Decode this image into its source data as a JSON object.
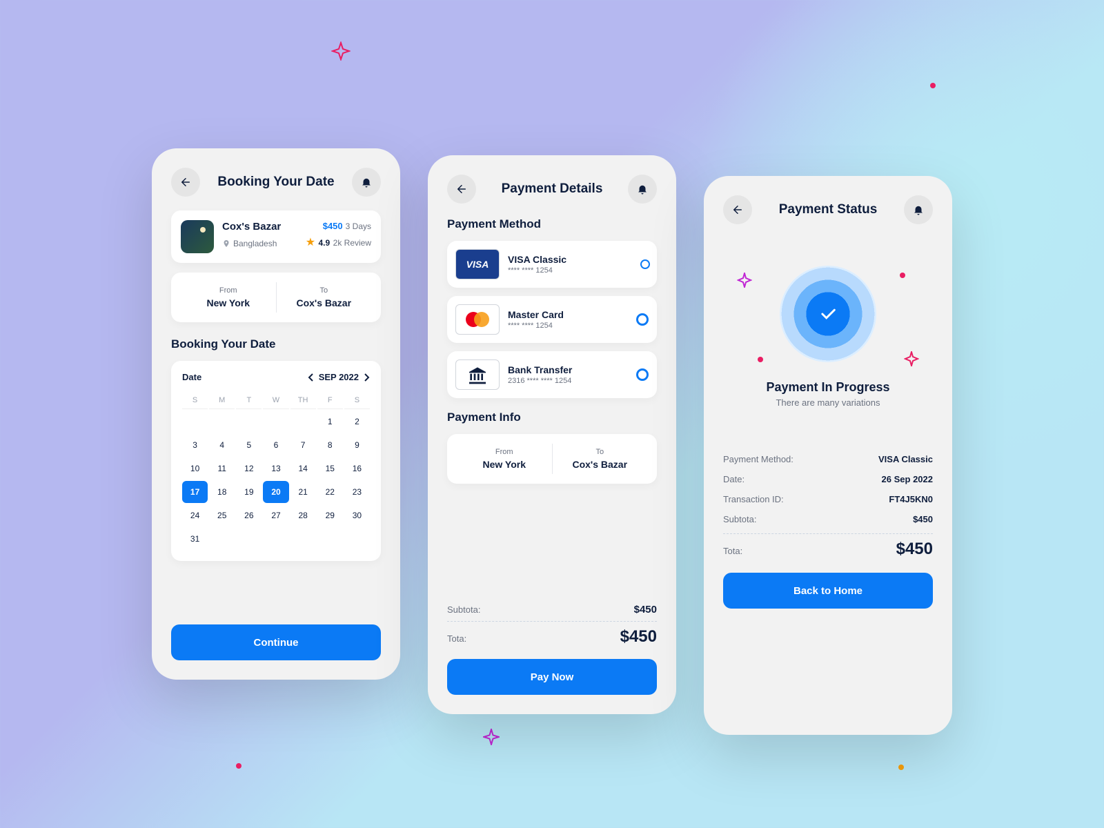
{
  "phone1": {
    "title": "Booking Your Date",
    "destination": {
      "name": "Cox's Bazar",
      "location": "Bangladesh",
      "price": "$450",
      "duration": "3 Days",
      "rating": "4.9",
      "reviews": "2k Review"
    },
    "route": {
      "from_label": "From",
      "from_value": "New York",
      "to_label": "To",
      "to_value": "Cox's Bazar"
    },
    "section": "Booking Your Date",
    "calendar": {
      "date_label": "Date",
      "month": "SEP 2022",
      "dows": [
        "S",
        "M",
        "T",
        "W",
        "TH",
        "F",
        "S"
      ],
      "days": [
        "",
        "",
        "",
        "",
        "",
        "1",
        "2",
        "3",
        "4",
        "5",
        "6",
        "7",
        "8",
        "9",
        "10",
        "11",
        "12",
        "13",
        "14",
        "15",
        "16",
        "17",
        "18",
        "19",
        "20",
        "21",
        "22",
        "23",
        "24",
        "25",
        "26",
        "27",
        "28",
        "29",
        "30",
        "31"
      ],
      "selected": [
        17,
        20
      ]
    },
    "cta": "Continue"
  },
  "phone2": {
    "title": "Payment Details",
    "method_title": "Payment Method",
    "methods": [
      {
        "name": "VISA Classic",
        "num": "**** **** 1254",
        "type": "visa",
        "checked": true
      },
      {
        "name": "Master Card",
        "num": "**** **** 1254",
        "type": "mc",
        "checked": false
      },
      {
        "name": "Bank Transfer",
        "num": "2316 **** **** 1254",
        "type": "bank",
        "checked": false
      }
    ],
    "info_title": "Payment Info",
    "route": {
      "from_label": "From",
      "from_value": "New York",
      "to_label": "To",
      "to_value": "Cox's Bazar"
    },
    "subtotal_label": "Subtota:",
    "subtotal": "$450",
    "total_label": "Tota:",
    "total": "$450",
    "cta": "Pay Now"
  },
  "phone3": {
    "title": "Payment Status",
    "status_title": "Payment In Progress",
    "status_sub": "There are many variations",
    "details": [
      {
        "label": "Payment Method:",
        "value": "VISA Classic"
      },
      {
        "label": "Date:",
        "value": "26 Sep 2022"
      },
      {
        "label": "Transaction ID:",
        "value": "FT4J5KN0"
      },
      {
        "label": "Subtota:",
        "value": "$450"
      }
    ],
    "total_label": "Tota:",
    "total": "$450",
    "cta": "Back to Home"
  }
}
